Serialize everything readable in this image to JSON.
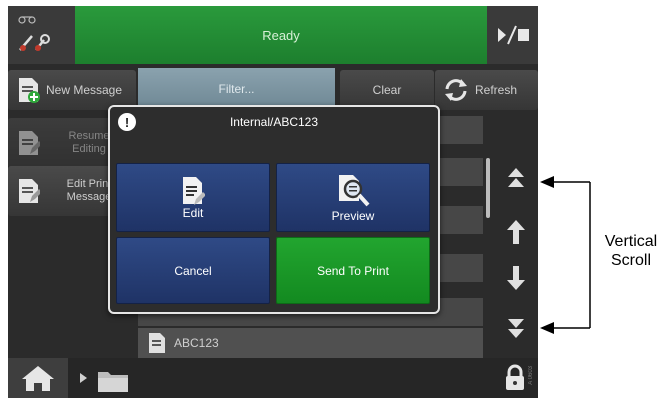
{
  "status": {
    "text": "Ready"
  },
  "toolbar": {
    "new_message": "New Message",
    "filter_placeholder": "Filter...",
    "clear": "Clear",
    "refresh": "Refresh"
  },
  "side": {
    "resume": "Resume Editing",
    "resume_line1": "Resume",
    "resume_line2": "Editing",
    "edit_print_line1": "Edit Print",
    "edit_print_line2": "Message"
  },
  "list": {
    "visible_item": "ABC123"
  },
  "dialog": {
    "title": "Internal/ABC123",
    "edit": "Edit",
    "preview": "Preview",
    "cancel": "Cancel",
    "send_to_print": "Send To Print"
  },
  "annotation": {
    "line1": "Vertical",
    "line2": "Scroll"
  },
  "footer": {
    "ref_code": "A 0603"
  },
  "colors": {
    "status_green": "#1d7f2e",
    "dialog_blue": "#1f3366",
    "send_green": "#138a20"
  }
}
